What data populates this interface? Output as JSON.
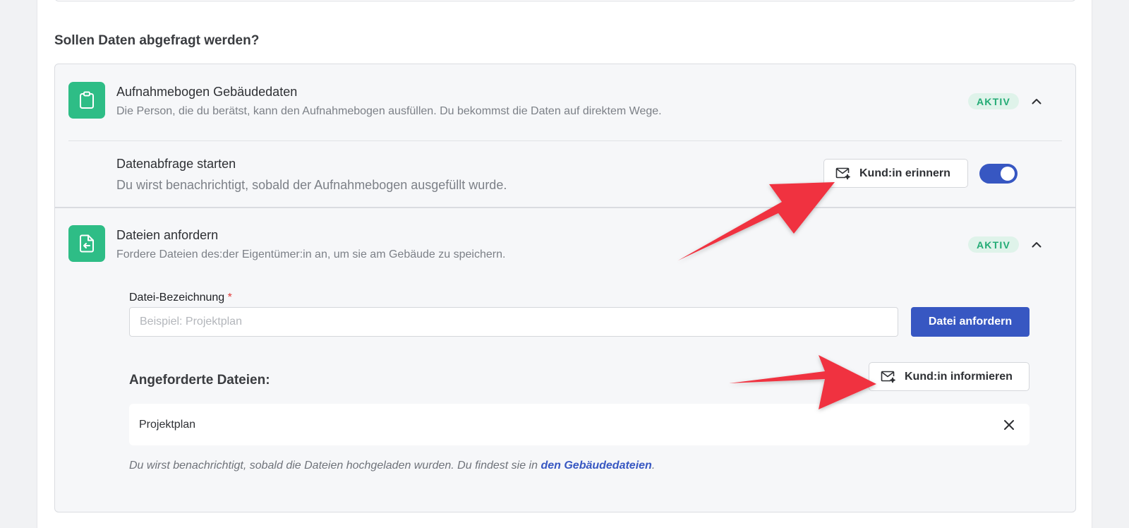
{
  "section": {
    "title": "Sollen Daten abgefragt werden?"
  },
  "items": [
    {
      "title": "Aufnahmebogen Gebäudedaten",
      "description": "Die Person, die du berätst, kann den Aufnahmebogen ausfüllen. Du bekommst die Daten auf direktem Wege.",
      "badge": "AKTIV",
      "icon": "clipboard-icon",
      "sub": {
        "title": "Datenabfrage starten",
        "description": "Du wirst benachrichtigt, sobald der Aufnahmebogen ausgefüllt wurde.",
        "remind_button": "Kund:in erinnern",
        "toggle_on": true
      }
    },
    {
      "title": "Dateien anfordern",
      "description": "Fordere Dateien des:der Eigentümer:in an, um sie am Gebäude zu speichern.",
      "badge": "AKTIV",
      "icon": "file-import-icon",
      "form": {
        "label": "Datei-Bezeichnung",
        "required_mark": "*",
        "placeholder": "Beispiel: Projektplan",
        "submit_button": "Datei anfordern"
      },
      "files": {
        "heading": "Angeforderte Dateien:",
        "inform_button": "Kund:in informieren",
        "list": [
          "Projektplan"
        ]
      },
      "hint": {
        "text": "Du wirst benachrichtigt, sobald die Dateien hochgeladen wurden. Du findest sie in ",
        "link": "den Gebäudedateien",
        "suffix": "."
      }
    }
  ],
  "colors": {
    "accent": "#3757c2",
    "icon_green": "#2ebd86",
    "badge_text": "#23ab75",
    "annotation_arrow": "#f0333f"
  }
}
